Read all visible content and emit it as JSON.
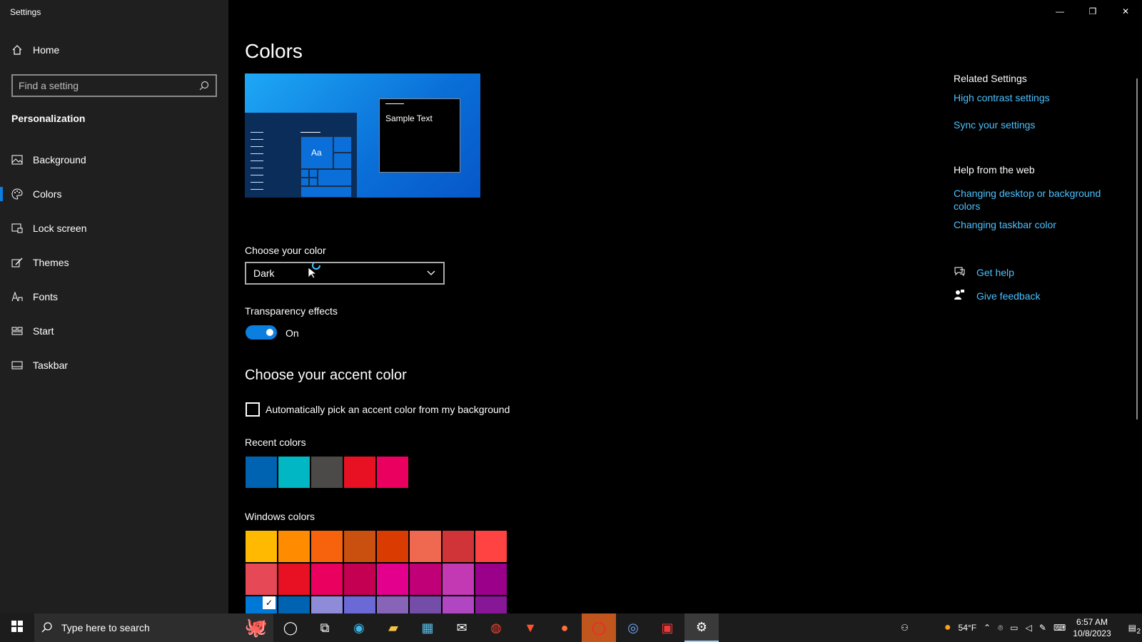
{
  "app": {
    "title": "Settings"
  },
  "sidebar": {
    "home_label": "Home",
    "search_placeholder": "Find a setting",
    "section": "Personalization",
    "items": [
      {
        "label": "Background",
        "icon": "image-icon"
      },
      {
        "label": "Colors",
        "icon": "palette-icon",
        "active": true
      },
      {
        "label": "Lock screen",
        "icon": "lock-screen-icon"
      },
      {
        "label": "Themes",
        "icon": "brush-icon"
      },
      {
        "label": "Fonts",
        "icon": "font-icon"
      },
      {
        "label": "Start",
        "icon": "start-icon"
      },
      {
        "label": "Taskbar",
        "icon": "taskbar-icon"
      }
    ]
  },
  "main": {
    "title": "Colors",
    "preview": {
      "sample_text": "Sample Text",
      "tile_text": "Aa"
    },
    "choose_color_label": "Choose your color",
    "choose_color_value": "Dark",
    "transparency_label": "Transparency effects",
    "transparency_state": "On",
    "accent_title": "Choose your accent color",
    "auto_accent_label": "Automatically pick an accent color from my background",
    "recent_colors_label": "Recent colors",
    "recent_colors": [
      "#0063b1",
      "#00b7c3",
      "#4c4a48",
      "#e81123",
      "#ea005e"
    ],
    "windows_colors_label": "Windows colors",
    "windows_colors": [
      "#ffb900",
      "#ff8c00",
      "#f7630c",
      "#ca5010",
      "#da3b01",
      "#ef6950",
      "#d13438",
      "#ff4343",
      "#e74856",
      "#e81123",
      "#ea005e",
      "#c30052",
      "#e3008c",
      "#bf0077",
      "#c239b3",
      "#9a0089",
      "#0078d7",
      "#0063b1",
      "#8e8cd8",
      "#6b69d6",
      "#8764b8",
      "#744da9",
      "#b146c2",
      "#881798"
    ],
    "selected_windows_color_index": 16
  },
  "related": {
    "heading": "Related Settings",
    "links": [
      "High contrast settings",
      "Sync your settings"
    ],
    "help_heading": "Help from the web",
    "help_links": [
      "Changing desktop or background colors",
      "Changing taskbar color"
    ],
    "get_help": "Get help",
    "give_feedback": "Give feedback"
  },
  "taskbar": {
    "search_placeholder": "Type here to search",
    "temperature": "54°F",
    "time": "6:57 AM",
    "date": "10/8/2023",
    "notification_count": "2"
  },
  "colors": {
    "accent": "#0a7fe0",
    "link": "#4cc2ff",
    "sidebar_bg": "#1f1f1f"
  }
}
